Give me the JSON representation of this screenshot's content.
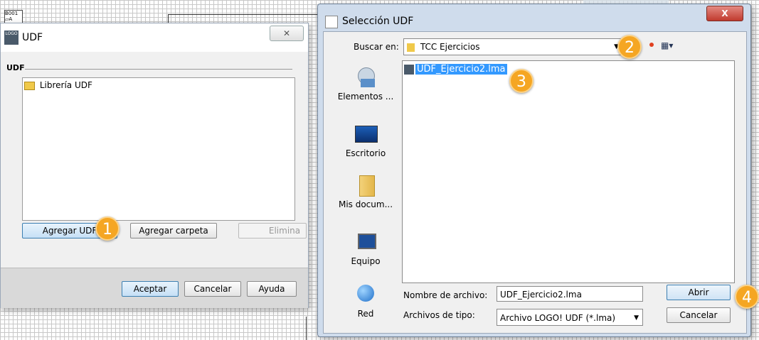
{
  "background": {
    "block_label": "B001"
  },
  "udf_window": {
    "title": "UDF",
    "logo_text": "LOGO",
    "group_label": "UDF",
    "tree_items": [
      {
        "label": "Librería UDF"
      }
    ],
    "buttons": {
      "add_udf": "Agregar UDF",
      "add_folder": "Agregar carpeta",
      "delete": "Elimina",
      "ok": "Aceptar",
      "cancel": "Cancelar",
      "help": "Ayuda"
    }
  },
  "file_dialog": {
    "title": "Selección UDF",
    "look_in_label": "Buscar en:",
    "look_in_value": "TCC Ejercicios",
    "places": [
      {
        "label": "Elementos ...",
        "icon": "recent-items-icon"
      },
      {
        "label": "Escritorio",
        "icon": "desktop-icon"
      },
      {
        "label": "Mis docum...",
        "icon": "documents-folder-icon"
      },
      {
        "label": "Equipo",
        "icon": "computer-icon"
      },
      {
        "label": "Red",
        "icon": "network-globe-icon"
      }
    ],
    "files": [
      {
        "name": "UDF_Ejercicio2.lma",
        "selected": true,
        "icon": "logo-file-icon"
      }
    ],
    "filename_label": "Nombre de archivo:",
    "filename_value": "UDF_Ejercicio2.lma",
    "filetype_label": "Archivos de tipo:",
    "filetype_value": "Archivo LOGO! UDF (*.lma)",
    "open_button": "Abrir",
    "cancel_button": "Cancelar",
    "close_glyph": "X"
  },
  "callouts": [
    "1",
    "2",
    "3",
    "4"
  ],
  "colors": {
    "callout": "#f5a623",
    "selection": "#3399ff",
    "close_button": "#c75050",
    "title_bar": "#d7e4f2"
  }
}
